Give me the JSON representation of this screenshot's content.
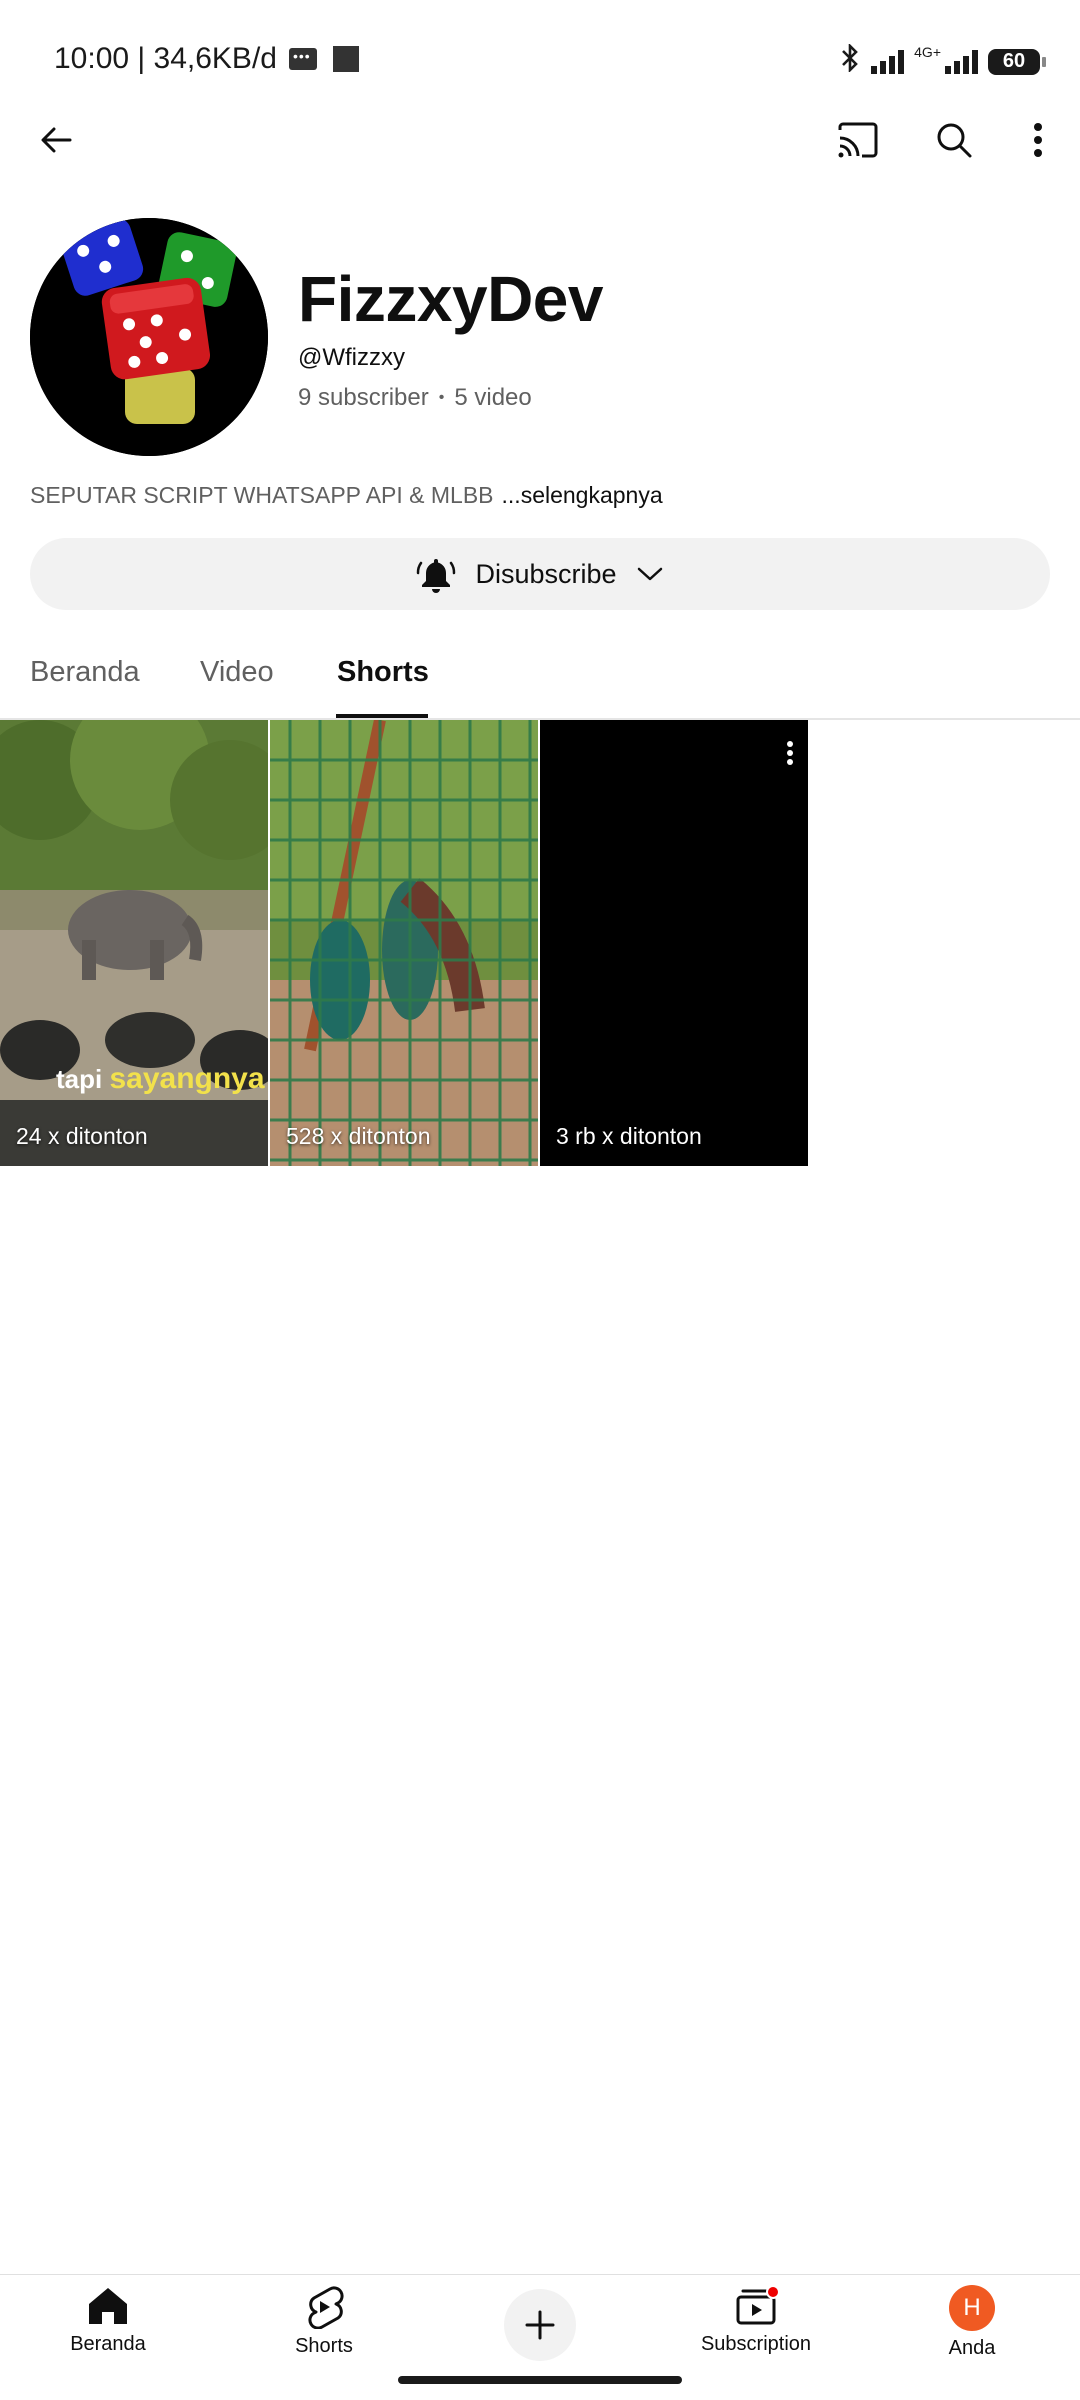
{
  "status_bar": {
    "time_info": "10:00 | 34,6KB/d",
    "network_label": "4G+",
    "battery": "60"
  },
  "channel": {
    "name": "FizzxyDev",
    "handle": "@Wfizzxy",
    "subscribers": "9 subscriber",
    "videos": "5 video",
    "description": "SEPUTAR SCRIPT WHATSAPP API & MLBB",
    "more_link": "...selengkapnya",
    "subscribe_label": "Disubscribe"
  },
  "tabs": [
    {
      "label": "Beranda"
    },
    {
      "label": "Video"
    },
    {
      "label": "Shorts"
    }
  ],
  "shorts": [
    {
      "views": "24 x ditonton",
      "caption_a": "tapi",
      "caption_b": "sayangnya"
    },
    {
      "views": "528 x ditonton"
    },
    {
      "views": "3 rb x ditonton"
    }
  ],
  "bottom_nav": {
    "home": "Beranda",
    "shorts": "Shorts",
    "subscriptions": "Subscription",
    "you": "Anda",
    "avatar_letter": "H"
  },
  "colors": {
    "accent_avatar": "#f05a22",
    "notification": "#ee0000"
  }
}
